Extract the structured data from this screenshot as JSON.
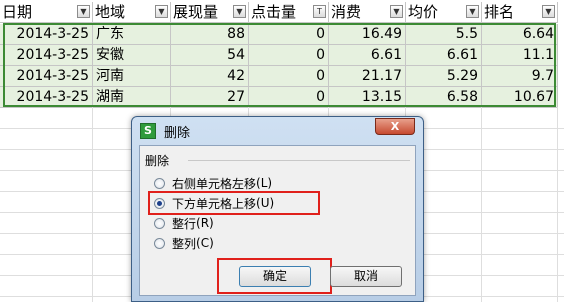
{
  "sheet": {
    "headers": [
      "日期",
      "地域",
      "展现量",
      "点击量",
      "消费",
      "均价",
      "排名"
    ],
    "header_filter_glyph": "▼",
    "clicks_filter_glyph": "T",
    "rows": [
      [
        "2014-3-25",
        "广东",
        "88",
        "0",
        "16.49",
        "5.5",
        "6.64"
      ],
      [
        "2014-3-25",
        "安徽",
        "54",
        "0",
        "6.61",
        "6.61",
        "11.1"
      ],
      [
        "2014-3-25",
        "河南",
        "42",
        "0",
        "21.17",
        "5.29",
        "9.7"
      ],
      [
        "2014-3-25",
        "湖南",
        "27",
        "0",
        "13.15",
        "6.58",
        "10.67"
      ]
    ],
    "selection_color": "#3c8a34",
    "row_fill_color": "#e6f1df"
  },
  "dialog": {
    "icon_glyph": "S",
    "title": "删除",
    "close_glyph": "X",
    "group_label": "删除",
    "options": [
      {
        "label": "右侧单元格左移",
        "hotkey": "(L)",
        "checked": false
      },
      {
        "label": "下方单元格上移",
        "hotkey": "(U)",
        "checked": true
      },
      {
        "label": "整行",
        "hotkey": "(R)",
        "checked": false
      },
      {
        "label": "整列",
        "hotkey": "(C)",
        "checked": false
      }
    ],
    "ok_label": "确定",
    "cancel_label": "取消",
    "highlight_color": "#e0201b"
  }
}
